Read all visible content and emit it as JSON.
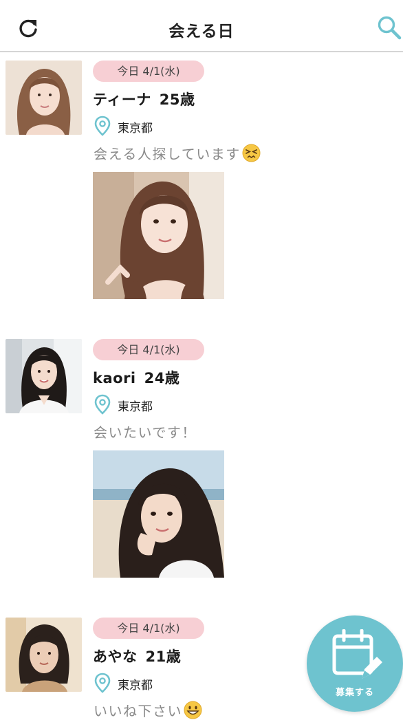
{
  "header": {
    "title": "会える日",
    "refresh_icon": "refresh-icon",
    "search_icon": "search-icon"
  },
  "colors": {
    "accent": "#6ec3cf",
    "pill": "#f7cfd4",
    "message": "#8a8a8a"
  },
  "posts": [
    {
      "date": "今日 4/1(水)",
      "name": "ティーナ",
      "age": "25歳",
      "location": "東京都",
      "message": "会える人探しています",
      "emoji": "persevering-face-emoji"
    },
    {
      "date": "今日 4/1(水)",
      "name": "kaori",
      "age": "24歳",
      "location": "東京都",
      "message": "会いたいです！",
      "emoji": ""
    },
    {
      "date": "今日 4/1(水)",
      "name": "あやな",
      "age": "21歳",
      "location": "東京都",
      "message": "いいね下さい",
      "emoji": "grinning-face-emoji"
    }
  ],
  "fab": {
    "label": "募集する",
    "icon": "calendar-edit-icon"
  }
}
